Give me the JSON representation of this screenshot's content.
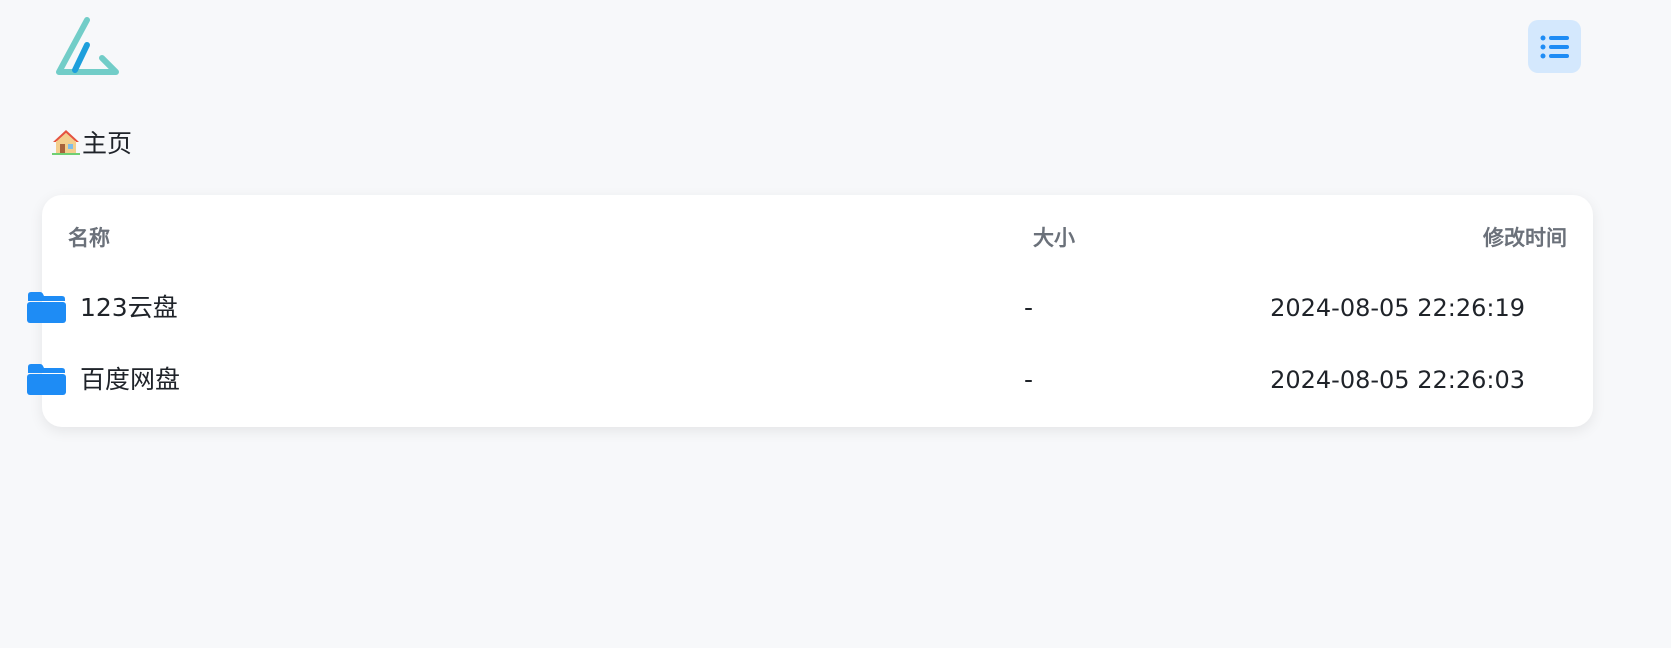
{
  "colors": {
    "accent": "#1e8cf5",
    "background": "#f7f8fa",
    "menu_button_bg": "#d4e8fd",
    "logo_teal": "#72cdc8",
    "logo_blue": "#1e9fdc"
  },
  "header": {
    "logo_icon": "app-logo",
    "menu_icon": "list-icon"
  },
  "breadcrumb": {
    "home_icon": "house-icon",
    "label": "主页"
  },
  "table": {
    "columns": {
      "name": "名称",
      "size": "大小",
      "modified": "修改时间"
    },
    "rows": [
      {
        "icon": "folder-icon",
        "name": "123云盘",
        "size": "-",
        "modified": "2024-08-05 22:26:19"
      },
      {
        "icon": "folder-icon",
        "name": "百度网盘",
        "size": "-",
        "modified": "2024-08-05 22:26:03"
      }
    ]
  }
}
